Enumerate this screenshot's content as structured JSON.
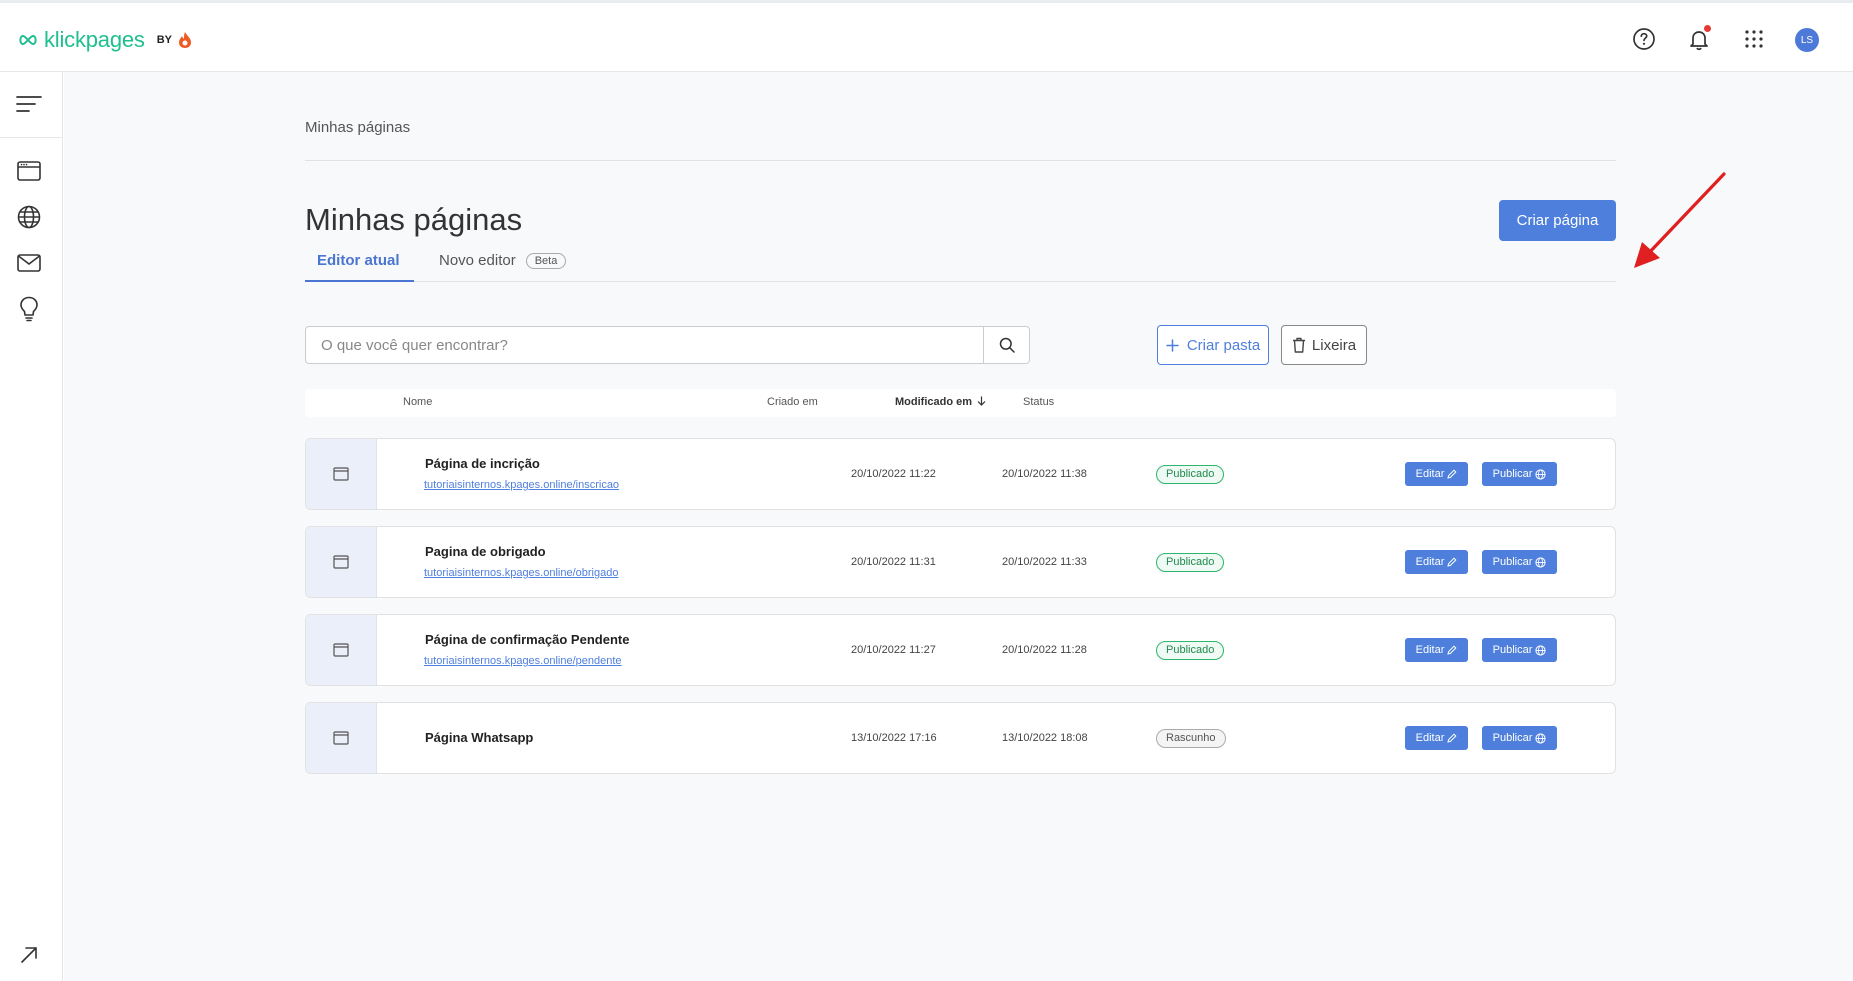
{
  "brand": {
    "name": "klickpages",
    "by": "BY"
  },
  "header": {
    "help_icon": "help-circle-icon",
    "notifications_icon": "bell-icon",
    "apps_icon": "grid-dots-icon",
    "avatar_initials": "LS",
    "notification_dot_color": "#e53935"
  },
  "sidebar": {
    "items": [
      {
        "icon": "menu-icon"
      },
      {
        "icon": "browser-window-icon"
      },
      {
        "icon": "globe-icon"
      },
      {
        "icon": "mail-icon"
      },
      {
        "icon": "lightbulb-icon"
      },
      {
        "icon": "external-arrow-icon"
      }
    ]
  },
  "breadcrumb": "Minhas páginas",
  "page_title": "Minhas páginas",
  "create_page_button": "Criar página",
  "tabs": {
    "active": "Editor atual",
    "inactive": "Novo editor",
    "beta_badge": "Beta"
  },
  "search": {
    "placeholder": "O que você quer encontrar?",
    "value": ""
  },
  "create_folder_button": "Criar pasta",
  "trash_button": "Lixeira",
  "table": {
    "columns": {
      "name": "Nome",
      "created": "Criado em",
      "modified": "Modificado em",
      "status": "Status"
    },
    "rows": [
      {
        "name": "Página de incrição",
        "url": "tutoriaisinternos.kpages.online/inscricao",
        "created": "20/10/2022 11:22",
        "modified": "20/10/2022 11:38",
        "status": "Publicado",
        "edit": "Editar",
        "publish": "Publicar"
      },
      {
        "name": "Pagina de obrigado",
        "url": "tutoriaisinternos.kpages.online/obrigado",
        "created": "20/10/2022 11:31",
        "modified": "20/10/2022 11:33",
        "status": "Publicado",
        "edit": "Editar",
        "publish": "Publicar"
      },
      {
        "name": "Página de confirmação Pendente",
        "url": "tutoriaisinternos.kpages.online/pendente",
        "created": "20/10/2022 11:27",
        "modified": "20/10/2022 11:28",
        "status": "Publicado",
        "edit": "Editar",
        "publish": "Publicar"
      },
      {
        "name": "Página Whatsapp",
        "url": "",
        "created": "13/10/2022 17:16",
        "modified": "13/10/2022 18:08",
        "status": "Rascunho",
        "edit": "Editar",
        "publish": "Publicar"
      }
    ]
  },
  "colors": {
    "primary": "#4f7fdc",
    "brand_green": "#1fbf8f",
    "status_published": "#2db56b",
    "annotation_arrow": "#e02020"
  }
}
